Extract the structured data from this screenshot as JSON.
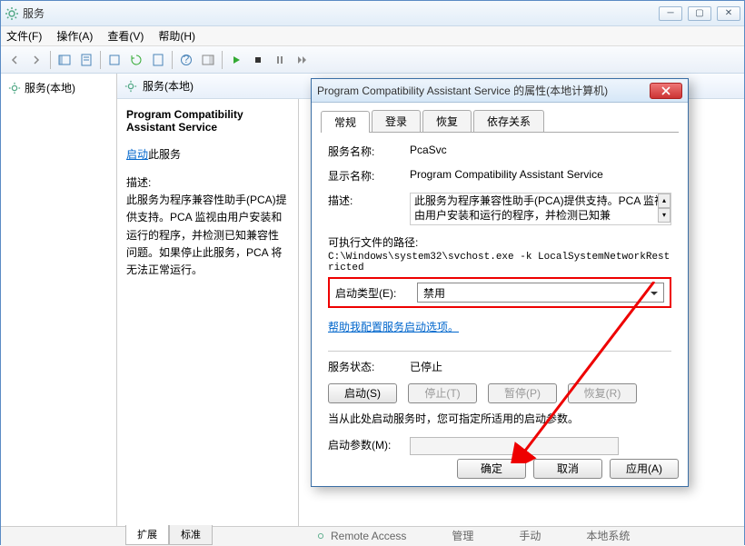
{
  "window": {
    "title": "服务"
  },
  "menu": {
    "file": "文件(F)",
    "action": "操作(A)",
    "view": "查看(V)",
    "help": "帮助(H)"
  },
  "left_pane": {
    "item": "服务(本地)"
  },
  "right_header": "服务(本地)",
  "detail": {
    "title": "Program Compatibility Assistant Service",
    "start_link": "启动",
    "start_suffix": "此服务",
    "desc_label": "描述:",
    "desc_text": "此服务为程序兼容性助手(PCA)提供支持。PCA 监视由用户安装和运行的程序，并检测已知兼容性问题。如果停止此服务，PCA 将无法正常运行。"
  },
  "bottom_tabs": {
    "extended": "扩展",
    "standard": "标准"
  },
  "dialog": {
    "title": "Program Compatibility Assistant Service 的属性(本地计算机)",
    "tabs": {
      "general": "常规",
      "logon": "登录",
      "recovery": "恢复",
      "dependencies": "依存关系"
    },
    "labels": {
      "service_name": "服务名称:",
      "display_name": "显示名称:",
      "description": "描述:",
      "path_label": "可执行文件的路径:",
      "startup_type": "启动类型(E):",
      "help_link": "帮助我配置服务启动选项。",
      "status_label": "服务状态:",
      "start_hint": "当从此处启动服务时，您可指定所适用的启动参数。",
      "start_params": "启动参数(M):"
    },
    "values": {
      "service_name": "PcaSvc",
      "display_name": "Program Compatibility Assistant Service",
      "description": "此服务为程序兼容性助手(PCA)提供支持。PCA 监视由用户安装和运行的程序，并检测已知兼",
      "path": "C:\\Windows\\system32\\svchost.exe -k LocalSystemNetworkRestricted",
      "startup_type": "禁用",
      "status": "已停止"
    },
    "buttons": {
      "start": "启动(S)",
      "stop": "停止(T)",
      "pause": "暂停(P)",
      "resume": "恢复(R)",
      "ok": "确定",
      "cancel": "取消",
      "apply": "应用(A)"
    }
  },
  "peek": {
    "service": "Remote Access",
    "c1": "管理",
    "c2": "手动",
    "c3": "本地系统"
  }
}
